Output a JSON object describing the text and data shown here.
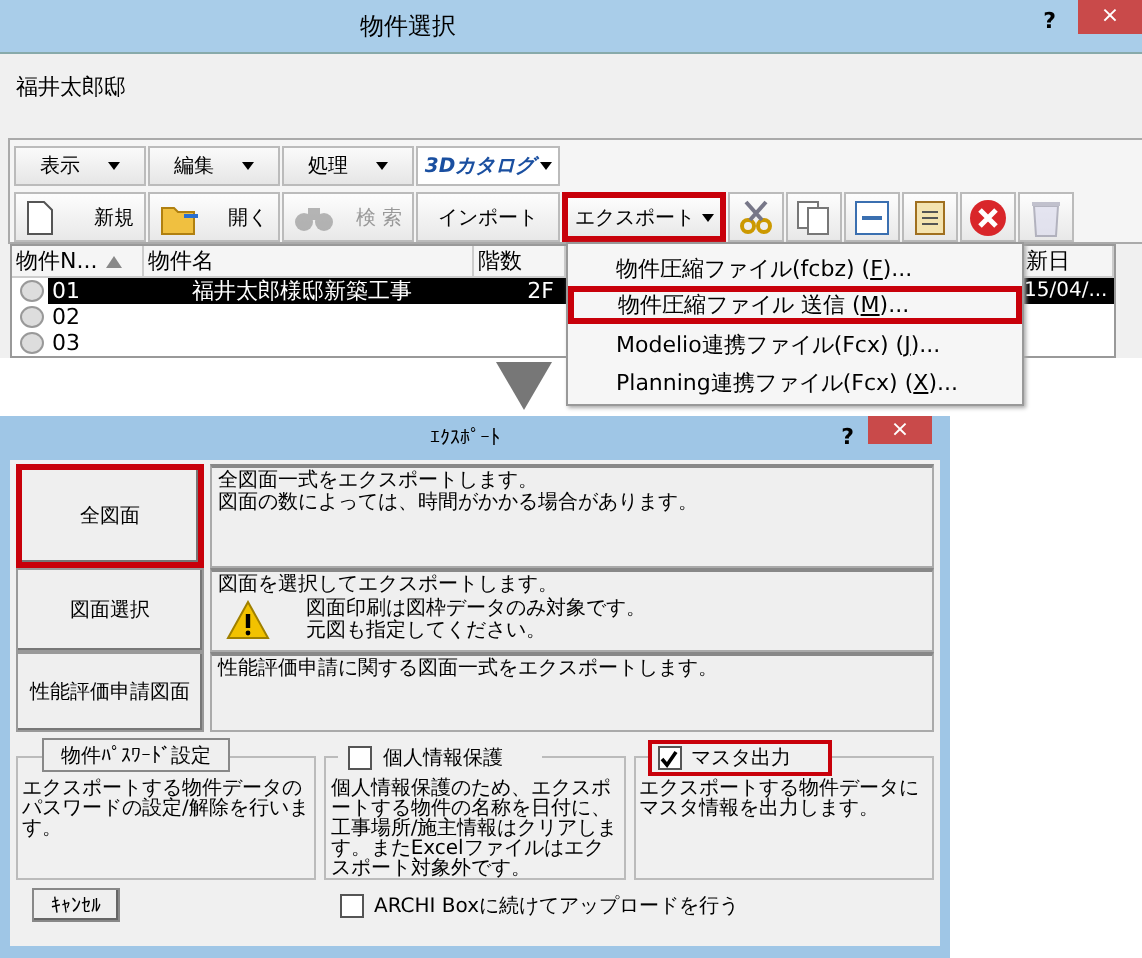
{
  "top_window": {
    "title": "物件選択",
    "help": "?",
    "close": "×",
    "project_name": "福井太郎邸",
    "menus": [
      {
        "kind": "menu",
        "label": "表示"
      },
      {
        "kind": "menu",
        "label": "編集"
      },
      {
        "kind": "menu",
        "label": "処理"
      },
      {
        "kind": "logo",
        "label": "3Dカタログ"
      }
    ],
    "toolbar": [
      {
        "kind": "new",
        "label": "新規",
        "disabled": false,
        "highlighted": false
      },
      {
        "kind": "open",
        "label": "開く",
        "disabled": false,
        "highlighted": false
      },
      {
        "kind": "search",
        "label": "検 索",
        "disabled": true,
        "highlighted": false
      },
      {
        "kind": "import",
        "label": "インポート",
        "disabled": false,
        "highlighted": false
      },
      {
        "kind": "export",
        "label": "エクスポート",
        "disabled": false,
        "highlighted": true
      },
      {
        "kind": "cut",
        "disabled": false,
        "highlighted": false
      },
      {
        "kind": "copy",
        "disabled": false,
        "highlighted": false
      },
      {
        "kind": "split",
        "disabled": false,
        "highlighted": false
      },
      {
        "kind": "paste",
        "disabled": false,
        "highlighted": false
      },
      {
        "kind": "delete",
        "disabled": false,
        "highlighted": false
      },
      {
        "kind": "trash",
        "disabled": true,
        "highlighted": false
      }
    ],
    "table": {
      "columns": [
        {
          "label": "物件N...",
          "sorted": true
        },
        {
          "label": "物件名",
          "sorted": false
        },
        {
          "label": "階数",
          "sorted": false
        },
        {
          "label": "新日",
          "sorted": false
        }
      ],
      "rows": [
        {
          "cells": [
            "01",
            "福井太郎様邸新築工事",
            "2F",
            "15/04/..."
          ],
          "selected": true
        },
        {
          "cells": [
            "02"
          ],
          "selected": false
        },
        {
          "cells": [
            "03"
          ],
          "selected": false
        }
      ]
    },
    "export_menu": [
      {
        "label": "物件圧縮ファイル(fcbz) (",
        "key": "F",
        "suffix": ")...",
        "highlighted": false
      },
      {
        "label": "物件圧縮ファイル 送信 (",
        "key": "M",
        "suffix": ")...",
        "highlighted": true
      },
      {
        "label": "Modelio連携ファイル(Fcx) (",
        "key": "J",
        "suffix": ")...",
        "highlighted": false
      },
      {
        "label": "Planning連携ファイル(Fcx) (",
        "key": "X",
        "suffix": ")...",
        "highlighted": false
      }
    ]
  },
  "export_dialog": {
    "title": "ｴｸｽﾎﾟｰﾄ",
    "help": "?",
    "close": "×",
    "options": [
      {
        "kind": "text",
        "button": "全図面",
        "lines": [
          "全図面一式をエクスポートします。",
          "図面の数によっては、時間がかかる場合があります。"
        ],
        "highlighted": true
      },
      {
        "kind": "warning",
        "button": "図面選択",
        "lines": [
          "図面を選択してエクスポートします。"
        ],
        "warning_lines": [
          "図面印刷は図枠データのみ対象です。",
          "元図も指定してください。"
        ],
        "highlighted": false
      },
      {
        "kind": "text",
        "button": "性能評価申請図面",
        "lines": [
          "性能評価申請に関する図面一式をエクスポートします。"
        ],
        "highlighted": false
      }
    ],
    "groups": [
      {
        "kind": "button",
        "label": "物件ﾊﾟｽﾜｰﾄﾞ設定",
        "text": "エクスポートする物件データのパスワードの設定/解除を行います。",
        "highlighted": false
      },
      {
        "kind": "checkbox",
        "label": "個人情報保護",
        "checked": false,
        "text": "個人情報保護のため、エクスポートする物件の名称を日付に、工事場所/施主情報はクリアします。またExcelファイルはエクスポート対象外です。",
        "highlighted": false
      },
      {
        "kind": "checkbox",
        "label": "マスタ出力",
        "checked": true,
        "text": "エクスポートする物件データにマスタ情報を出力します。",
        "highlighted": true
      }
    ],
    "cancel": "ｷｬﾝｾﾙ",
    "upload": {
      "label": "ARCHI Boxに続けてアップロードを行う",
      "checked": false
    }
  }
}
